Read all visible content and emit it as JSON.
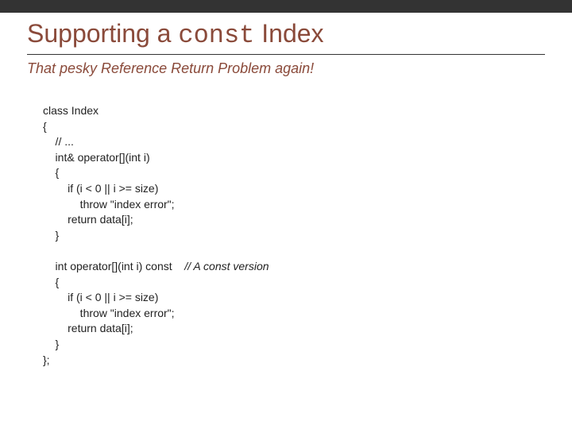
{
  "title": {
    "pre": "Supporting a ",
    "mono": "const",
    "post": " Index"
  },
  "subtitle": "That pesky Reference Return Problem again!",
  "code": {
    "l1": "class Index",
    "l2": "{",
    "l3": "    // ...",
    "l4": "    int& operator[](int i)",
    "l5": "    {",
    "l6": "        if (i < 0 || i >= size)",
    "l7": "            throw \"index error\";",
    "l8": "        return data[i];",
    "l9": "    }",
    "l10": "",
    "l11a": "    int operator[](int i) const    ",
    "l11b": "// A const version",
    "l12": "    {",
    "l13": "        if (i < 0 || i >= size)",
    "l14": "            throw \"index error\";",
    "l15": "        return data[i];",
    "l16": "    }",
    "l17": "};"
  }
}
